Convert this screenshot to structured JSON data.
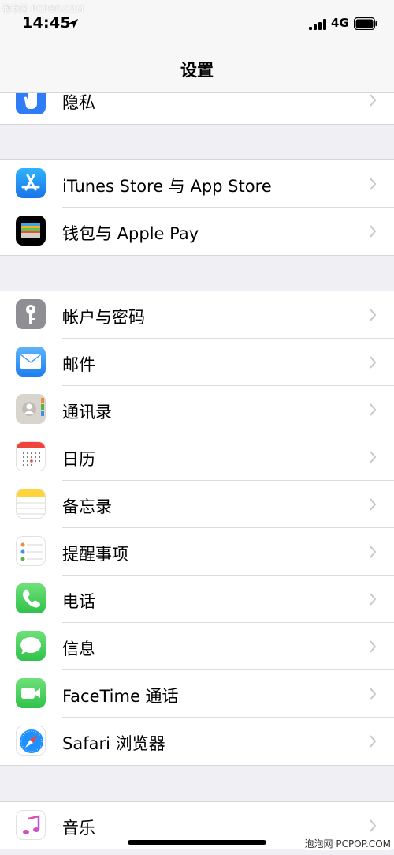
{
  "watermark_top": "泡泡网 PCPOP.COM",
  "watermark_bottom": "泡泡网 PCPOP.COM",
  "status_bar": {
    "time": "14:45",
    "network": "4G"
  },
  "nav": {
    "title": "设置"
  },
  "groups": [
    {
      "items": [
        {
          "label": "隐私",
          "icon": "privacy-hand-icon",
          "color": "#2f7cf6"
        }
      ]
    },
    {
      "items": [
        {
          "label": "iTunes Store 与 App Store",
          "icon": "app-store-icon",
          "color": "#1e8ef0"
        },
        {
          "label": "钱包与 Apple Pay",
          "icon": "wallet-icon",
          "color": "#000000"
        }
      ]
    },
    {
      "items": [
        {
          "label": "帐户与密码",
          "icon": "key-icon",
          "color": "#8e8e93"
        },
        {
          "label": "邮件",
          "icon": "mail-icon",
          "color": "#2d8cf0"
        },
        {
          "label": "通讯录",
          "icon": "contacts-icon",
          "color": "#d8d5cf"
        },
        {
          "label": "日历",
          "icon": "calendar-icon",
          "color": "#ffffff"
        },
        {
          "label": "备忘录",
          "icon": "notes-icon",
          "color": "#ffd43b"
        },
        {
          "label": "提醒事项",
          "icon": "reminders-icon",
          "color": "#ffffff"
        },
        {
          "label": "电话",
          "icon": "phone-icon",
          "color": "#4cd964"
        },
        {
          "label": "信息",
          "icon": "messages-icon",
          "color": "#4cd964"
        },
        {
          "label": "FaceTime 通话",
          "icon": "facetime-icon",
          "color": "#4cd964"
        },
        {
          "label": "Safari 浏览器",
          "icon": "safari-icon",
          "color": "#1e90ff"
        }
      ]
    },
    {
      "items": [
        {
          "label": "音乐",
          "icon": "music-icon",
          "color": "#ffffff"
        }
      ]
    }
  ]
}
